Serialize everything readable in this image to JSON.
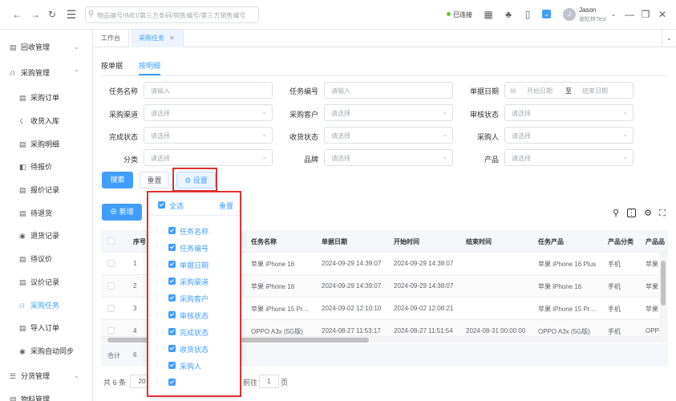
{
  "topbar": {
    "search_placeholder": "物品编号/IMEI/第三方条码/销售编号/第三方销售编号",
    "connection_status": "已连接",
    "user_name": "Jason",
    "user_org": "谢松林Test",
    "avatar_letter": "J"
  },
  "sidebar": {
    "groups": [
      {
        "label": "回收管理"
      },
      {
        "label": "采购管理"
      },
      {
        "label": "分货管理"
      },
      {
        "label": "物料管理"
      }
    ],
    "items": [
      {
        "label": "采购订单"
      },
      {
        "label": "收货入库"
      },
      {
        "label": "采购明细"
      },
      {
        "label": "待报价"
      },
      {
        "label": "报价记录"
      },
      {
        "label": "待退货"
      },
      {
        "label": "退货记录"
      },
      {
        "label": "待议价"
      },
      {
        "label": "议价记录"
      },
      {
        "label": "采购任务"
      },
      {
        "label": "导入订单"
      },
      {
        "label": "采购自动同步"
      }
    ]
  },
  "tabs": [
    {
      "label": "工作台"
    },
    {
      "label": "采购任务"
    }
  ],
  "subtabs": [
    {
      "label": "按单据"
    },
    {
      "label": "按明细"
    }
  ],
  "filters": {
    "task_name": {
      "label": "任务名称",
      "placeholder": "请输入"
    },
    "task_no": {
      "label": "任务编号",
      "placeholder": "请输入"
    },
    "doc_date": {
      "label": "单据日期",
      "start": "开始日期",
      "sep": "至",
      "end": "结束日期"
    },
    "channel": {
      "label": "采购渠道",
      "placeholder": "请选择"
    },
    "customer": {
      "label": "采购客户",
      "placeholder": "请选择"
    },
    "audit": {
      "label": "审核状态",
      "placeholder": "请选择"
    },
    "complete": {
      "label": "完成状态",
      "placeholder": "请选择"
    },
    "receive": {
      "label": "收货状态",
      "placeholder": "请选择"
    },
    "buyer": {
      "label": "采购人",
      "placeholder": "请选择"
    },
    "category": {
      "label": "分类",
      "placeholder": "请选择"
    },
    "brand": {
      "label": "品牌",
      "placeholder": "请选择"
    },
    "product": {
      "label": "产品",
      "placeholder": "请选择"
    }
  },
  "buttons": {
    "search": "搜索",
    "reset": "重置",
    "settings": "设置",
    "add": "新增"
  },
  "table": {
    "headers": [
      "序号",
      "任务名称",
      "单据日期",
      "开始时间",
      "结束时间",
      "任务产品",
      "产品分类",
      "产品品"
    ],
    "rows": [
      {
        "no": "1",
        "name": "苹果 iPhone 16",
        "date": "2024-09-29 14:39:07",
        "start": "2024-09-29 14:38:07",
        "end": "",
        "product": "苹果 iPhone 16 Plus",
        "cat": "手机",
        "brand": "苹果"
      },
      {
        "no": "2",
        "name": "苹果 iPhone 16",
        "date": "2024-09-29 14:39:07",
        "start": "2024-09-29 14:38:07",
        "end": "",
        "product": "苹果 iPhone 16",
        "cat": "手机",
        "brand": "苹果"
      },
      {
        "no": "3",
        "name": "苹果 iPhone 15 Pr…",
        "date": "2024-09-02 12:10:10",
        "start": "2024-09-02 12:08:21",
        "end": "",
        "product": "苹果 iPhone 15 Pr…",
        "cat": "手机",
        "brand": "苹果"
      },
      {
        "no": "4",
        "name": "OPPO A3x (5G版)",
        "date": "2024-08-27 11:53:17",
        "start": "2024-08-27 11:51:54",
        "end": "2024-08-31 00:00:00",
        "product": "OPPO A3x (5G版)",
        "cat": "手机",
        "brand": "OPP"
      }
    ],
    "sum_label": "合计",
    "sum_value": "6"
  },
  "pager": {
    "total": "共 6 条",
    "size": "20",
    "goto": "前往",
    "page": "1",
    "page_unit": "页"
  },
  "popup": {
    "select_all": "全选",
    "reset": "重置",
    "columns": [
      "任务名称",
      "任务编号",
      "单据日期",
      "采购渠道",
      "采购客户",
      "审核状态",
      "完成状态",
      "收货状态",
      "采购人",
      ""
    ]
  },
  "colors": {
    "accent": "#409eff",
    "highlight": "#e03131"
  }
}
